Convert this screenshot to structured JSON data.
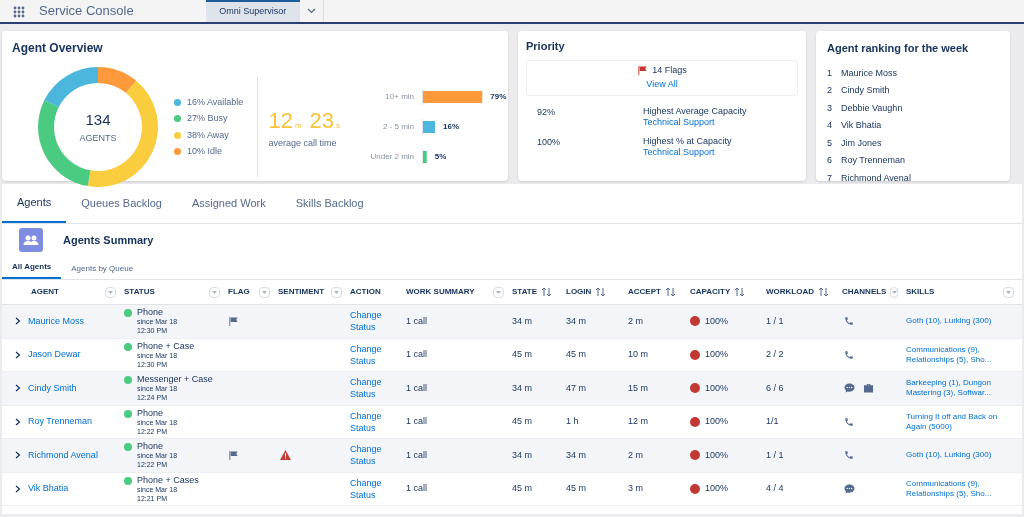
{
  "header": {
    "title": "Service Console",
    "tabs": [
      {
        "label": "Omni Supervisor",
        "selected": true
      }
    ]
  },
  "overview": {
    "title": "Agent Overview",
    "total": "134",
    "total_label": "AGENTS",
    "donut": {
      "chart_data": {
        "type": "donut",
        "categories": [
          "16% Available",
          "27% Busy",
          "38% Away",
          "10% Idle"
        ],
        "values": [
          16,
          27,
          38,
          10
        ],
        "colors": [
          "#4bb7dc",
          "#4bca81",
          "#f9cd3e",
          "#ff9a3c"
        ]
      }
    },
    "avg_minutes": "12",
    "minutes_unit": "m",
    "avg_seconds": "23",
    "seconds_unit": "s",
    "avg_label": "average call time",
    "bars": {
      "chart_data": {
        "type": "bar",
        "orientation": "horizontal",
        "categories": [
          "10+ min",
          "2 - 5 min",
          "Under 2 min"
        ],
        "values": [
          79,
          16,
          5
        ],
        "colors": [
          "#ff9a3c",
          "#4bb7dc",
          "#4bca81"
        ],
        "value_labels": [
          "79%",
          "16%",
          "5%"
        ]
      }
    }
  },
  "priority": {
    "title": "Priority",
    "flags": "14 Flags",
    "view_all": "View All",
    "stats": [
      {
        "value": "92%",
        "label": "Highest Average Capacity",
        "link": "Technical Support"
      },
      {
        "value": "100%",
        "label": "Highest % at Capacity",
        "link": "Technical Support"
      }
    ]
  },
  "ranking": {
    "title": "Agent ranking for the week",
    "items": [
      {
        "rank": "1",
        "name": "Maurice Moss"
      },
      {
        "rank": "2",
        "name": "Cindy Smith"
      },
      {
        "rank": "3",
        "name": "Debbie Vaughn"
      },
      {
        "rank": "4",
        "name": "Vik Bhatia"
      },
      {
        "rank": "5",
        "name": "Jim Jones"
      },
      {
        "rank": "6",
        "name": "Roy Trenneman"
      },
      {
        "rank": "7",
        "name": "Richmond Avenal"
      }
    ]
  },
  "tabs": [
    {
      "label": "Agents",
      "selected": true
    },
    {
      "label": "Queues Backlog",
      "selected": false
    },
    {
      "label": "Assigned Work",
      "selected": false
    },
    {
      "label": "Skills Backlog",
      "selected": false
    }
  ],
  "summary_title": "Agents Summary",
  "subtabs": [
    {
      "label": "All Agents",
      "selected": true
    },
    {
      "label": "Agents by Queue",
      "selected": false
    }
  ],
  "table": {
    "columns": [
      {
        "label": "AGENT",
        "kind": "filter"
      },
      {
        "label": "STATUS",
        "kind": "filter"
      },
      {
        "label": "FLAG",
        "kind": "filter"
      },
      {
        "label": "SENTIMENT",
        "kind": "filter"
      },
      {
        "label": "ACTION",
        "kind": "plain"
      },
      {
        "label": "WORK SUMMARY",
        "kind": "filter"
      },
      {
        "label": "STATE",
        "kind": "sort"
      },
      {
        "label": "LOGIN",
        "kind": "sort"
      },
      {
        "label": "ACCEPT",
        "kind": "sort"
      },
      {
        "label": "CAPACITY",
        "kind": "sort"
      },
      {
        "label": "WORKLOAD",
        "kind": "sort"
      },
      {
        "label": "CHANNELS",
        "kind": "filter"
      },
      {
        "label": "SKILLS",
        "kind": "filter"
      }
    ],
    "rows": [
      {
        "agent": "Maurice Moss",
        "status": "Phone",
        "since": "since Mar 18",
        "time": "12:30 PM",
        "flagged": true,
        "sentiment_alert": false,
        "action": "Change Status",
        "work": "1 call",
        "state": "34 m",
        "login": "34 m",
        "accept": "2 m",
        "capacity": "100%",
        "workload": "1 / 1",
        "channels": [
          {
            "kind": "phone"
          }
        ],
        "skills": "Goth (10), Lurking (300)"
      },
      {
        "agent": "Jason Dewar",
        "status": "Phone + Case",
        "since": "since Mar 18",
        "time": "12:30 PM",
        "flagged": false,
        "sentiment_alert": false,
        "action": "Change Status",
        "work": "1 call",
        "state": "45 m",
        "login": "45 m",
        "accept": "10 m",
        "capacity": "100%",
        "workload": "2 / 2",
        "channels": [
          {
            "kind": "phone"
          }
        ],
        "skills": "Communications (9), Relationships (5), Sho..."
      },
      {
        "agent": "Cindy Smith",
        "status": "Messenger + Case",
        "since": "since Mar 18",
        "time": "12:24 PM",
        "flagged": false,
        "sentiment_alert": false,
        "action": "Change Status",
        "work": "1 call",
        "state": "34 m",
        "login": "47 m",
        "accept": "15 m",
        "capacity": "100%",
        "workload": "6 / 6",
        "channels": [
          {
            "kind": "chat"
          },
          {
            "kind": "case"
          }
        ],
        "skills": "Barkeeping (1), Dungon Mastering (3), Softwar..."
      },
      {
        "agent": "Roy Trenneman",
        "status": "Phone",
        "since": "since Mar 18",
        "time": "12:22 PM",
        "flagged": false,
        "sentiment_alert": false,
        "action": "Change Status",
        "work": "1 call",
        "state": "45 m",
        "login": "1 h",
        "accept": "12 m",
        "capacity": "100%",
        "workload": "1/1",
        "channels": [
          {
            "kind": "phone"
          }
        ],
        "skills": "Turning It off and Back on Again (5000)"
      },
      {
        "agent": "Richmond Avenal",
        "status": "Phone",
        "since": "since Mar 18",
        "time": "12:22 PM",
        "flagged": true,
        "sentiment_alert": true,
        "action": "Change Status",
        "work": "1 call",
        "state": "34 m",
        "login": "34 m",
        "accept": "2 m",
        "capacity": "100%",
        "workload": "1 / 1",
        "channels": [
          {
            "kind": "phone"
          }
        ],
        "skills": "Goth (10), Lurking (300)"
      },
      {
        "agent": "Vik Bhatia",
        "status": "Phone + Cases",
        "since": "since Mar 18",
        "time": "12:21 PM",
        "flagged": false,
        "sentiment_alert": false,
        "action": "Change Status",
        "work": "1 call",
        "state": "45 m",
        "login": "45 m",
        "accept": "3 m",
        "capacity": "100%",
        "workload": "4 / 4",
        "channels": [
          {
            "kind": "chat"
          }
        ],
        "skills": "Communications (9), Relationships (5), Sho..."
      }
    ]
  }
}
